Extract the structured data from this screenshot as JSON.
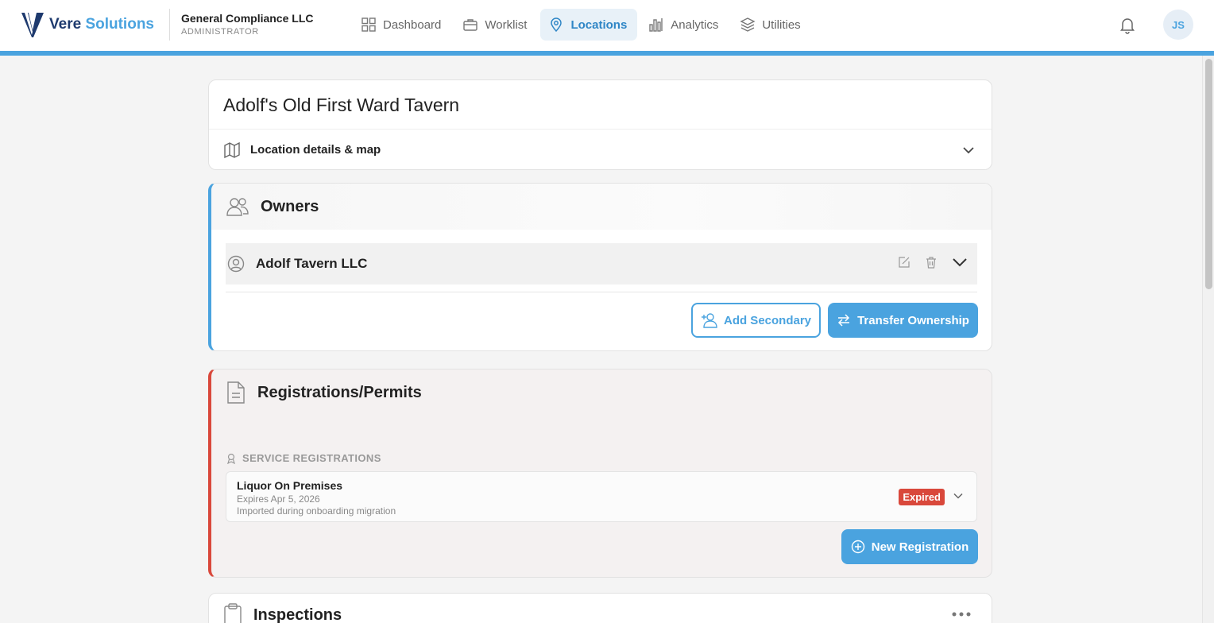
{
  "header": {
    "brand_primary": "Vere",
    "brand_accent": "Solutions",
    "org_name": "General Compliance LLC",
    "org_role": "ADMINISTRATOR",
    "nav": [
      {
        "label": "Dashboard",
        "icon": "grid-icon",
        "active": false
      },
      {
        "label": "Worklist",
        "icon": "briefcase-icon",
        "active": false
      },
      {
        "label": "Locations",
        "icon": "map-pin-icon",
        "active": true
      },
      {
        "label": "Analytics",
        "icon": "bar-chart-icon",
        "active": false
      },
      {
        "label": "Utilities",
        "icon": "layers-icon",
        "active": false
      }
    ],
    "user_initials": "JS"
  },
  "location": {
    "title": "Adolf's Old First Ward Tavern",
    "details_label": "Location details & map"
  },
  "owners": {
    "title": "Owners",
    "items": [
      {
        "name": "Adolf Tavern LLC"
      }
    ],
    "add_secondary_label": "Add Secondary",
    "transfer_label": "Transfer Ownership"
  },
  "registrations": {
    "title": "Registrations/Permits",
    "subsection": "SERVICE REGISTRATIONS",
    "items": [
      {
        "name": "Liquor On Premises",
        "expires": "Expires Apr 5, 2026",
        "note": "Imported during onboarding migration",
        "status": "Expired"
      }
    ],
    "new_label": "New Registration"
  },
  "inspections": {
    "title": "Inspections"
  },
  "colors": {
    "accent": "#4aa3df",
    "brand_dark": "#1e3a6e",
    "danger": "#d9483b"
  }
}
